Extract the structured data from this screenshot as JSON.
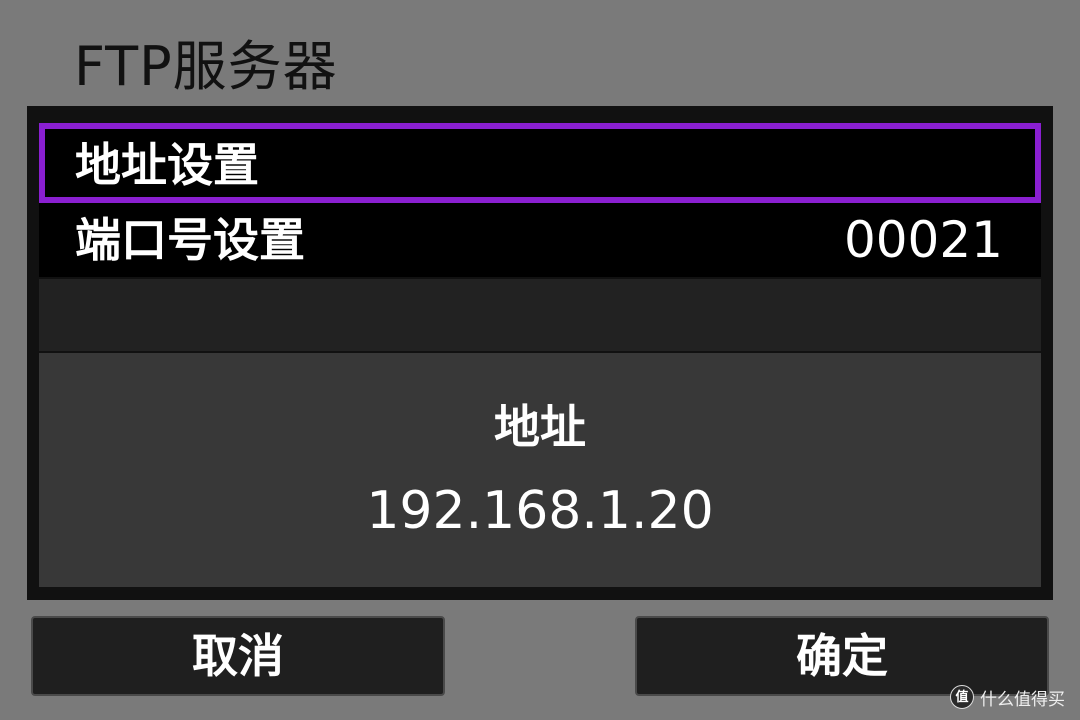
{
  "screen": {
    "title": "FTP服务器"
  },
  "menu": {
    "address_setting_label": "地址设置",
    "port_setting_label": "端口号设置",
    "port_value": "00021",
    "selected_item": "地址设置",
    "selection_color": "#8a1fd1"
  },
  "info": {
    "label": "地址",
    "value": "192.168.1.20"
  },
  "buttons": {
    "cancel_label": "取消",
    "ok_label": "确定"
  },
  "watermark": {
    "badge": "值",
    "text": "什么值得买"
  }
}
